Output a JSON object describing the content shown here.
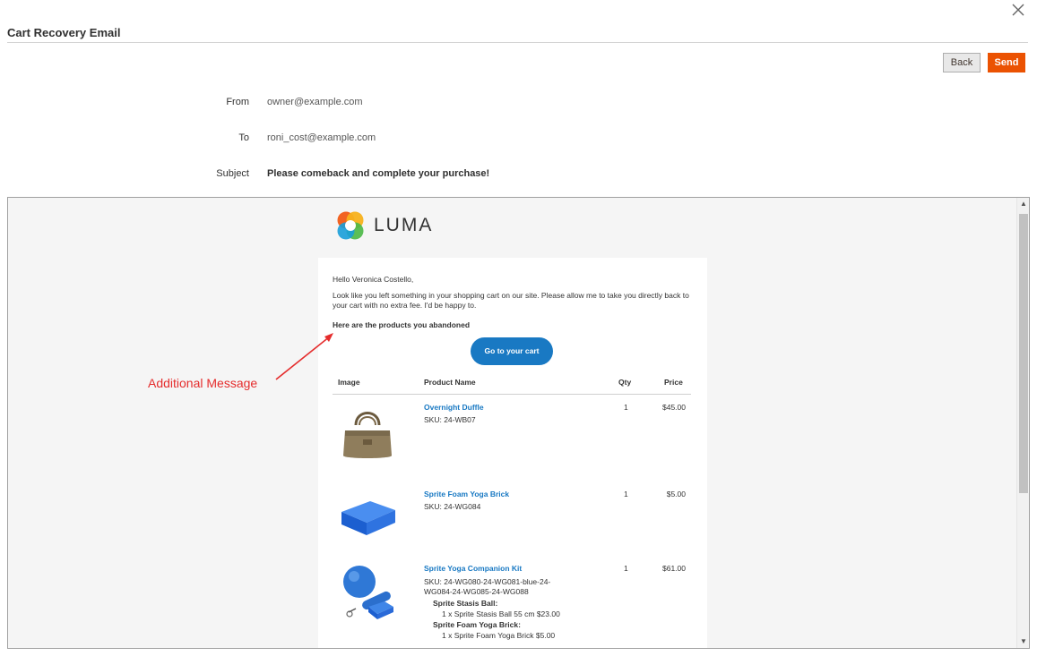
{
  "modal": {
    "title": "Cart Recovery Email",
    "close_icon": "close-icon"
  },
  "actions": {
    "back_label": "Back",
    "send_label": "Send"
  },
  "fields": {
    "from_label": "From",
    "from_value": "owner@example.com",
    "to_label": "To",
    "to_value": "roni_cost@example.com",
    "subject_label": "Subject",
    "subject_value": "Please comeback and complete your purchase!"
  },
  "preview": {
    "logo_text": "LUMA",
    "greeting": "Hello Veronica Costello,",
    "body": "Look like you left something in your shopping cart on our site. Please allow me to take you directly back to your cart with no extra fee. I'd be happy to.",
    "products_heading": "Here are the products you abandoned",
    "cart_button": "Go to your cart",
    "columns": {
      "image": "Image",
      "name": "Product Name",
      "qty": "Qty",
      "price": "Price"
    },
    "products": [
      {
        "name": "Overnight Duffle",
        "sku": "SKU: 24-WB07",
        "qty": "1",
        "price": "$45.00"
      },
      {
        "name": "Sprite Foam Yoga Brick",
        "sku": "SKU: 24-WG084",
        "qty": "1",
        "price": "$5.00"
      },
      {
        "name": "Sprite Yoga Companion Kit",
        "sku_line1": "SKU: 24-WG080-24-WG081-blue-24-",
        "sku_line2": "WG084-24-WG085-24-WG088",
        "qty": "1",
        "price": "$61.00",
        "option1_title": "Sprite Stasis Ball:",
        "option1_value": "1 x Sprite Stasis Ball 55 cm $23.00",
        "option2_title": "Sprite Foam Yoga Brick:",
        "option2_value": "1 x Sprite Foam Yoga Brick $5.00"
      }
    ]
  },
  "annotation": {
    "text": "Additional Message",
    "color": "#e52c2c"
  },
  "colors": {
    "send": "#eb5202",
    "link": "#1979c3"
  }
}
